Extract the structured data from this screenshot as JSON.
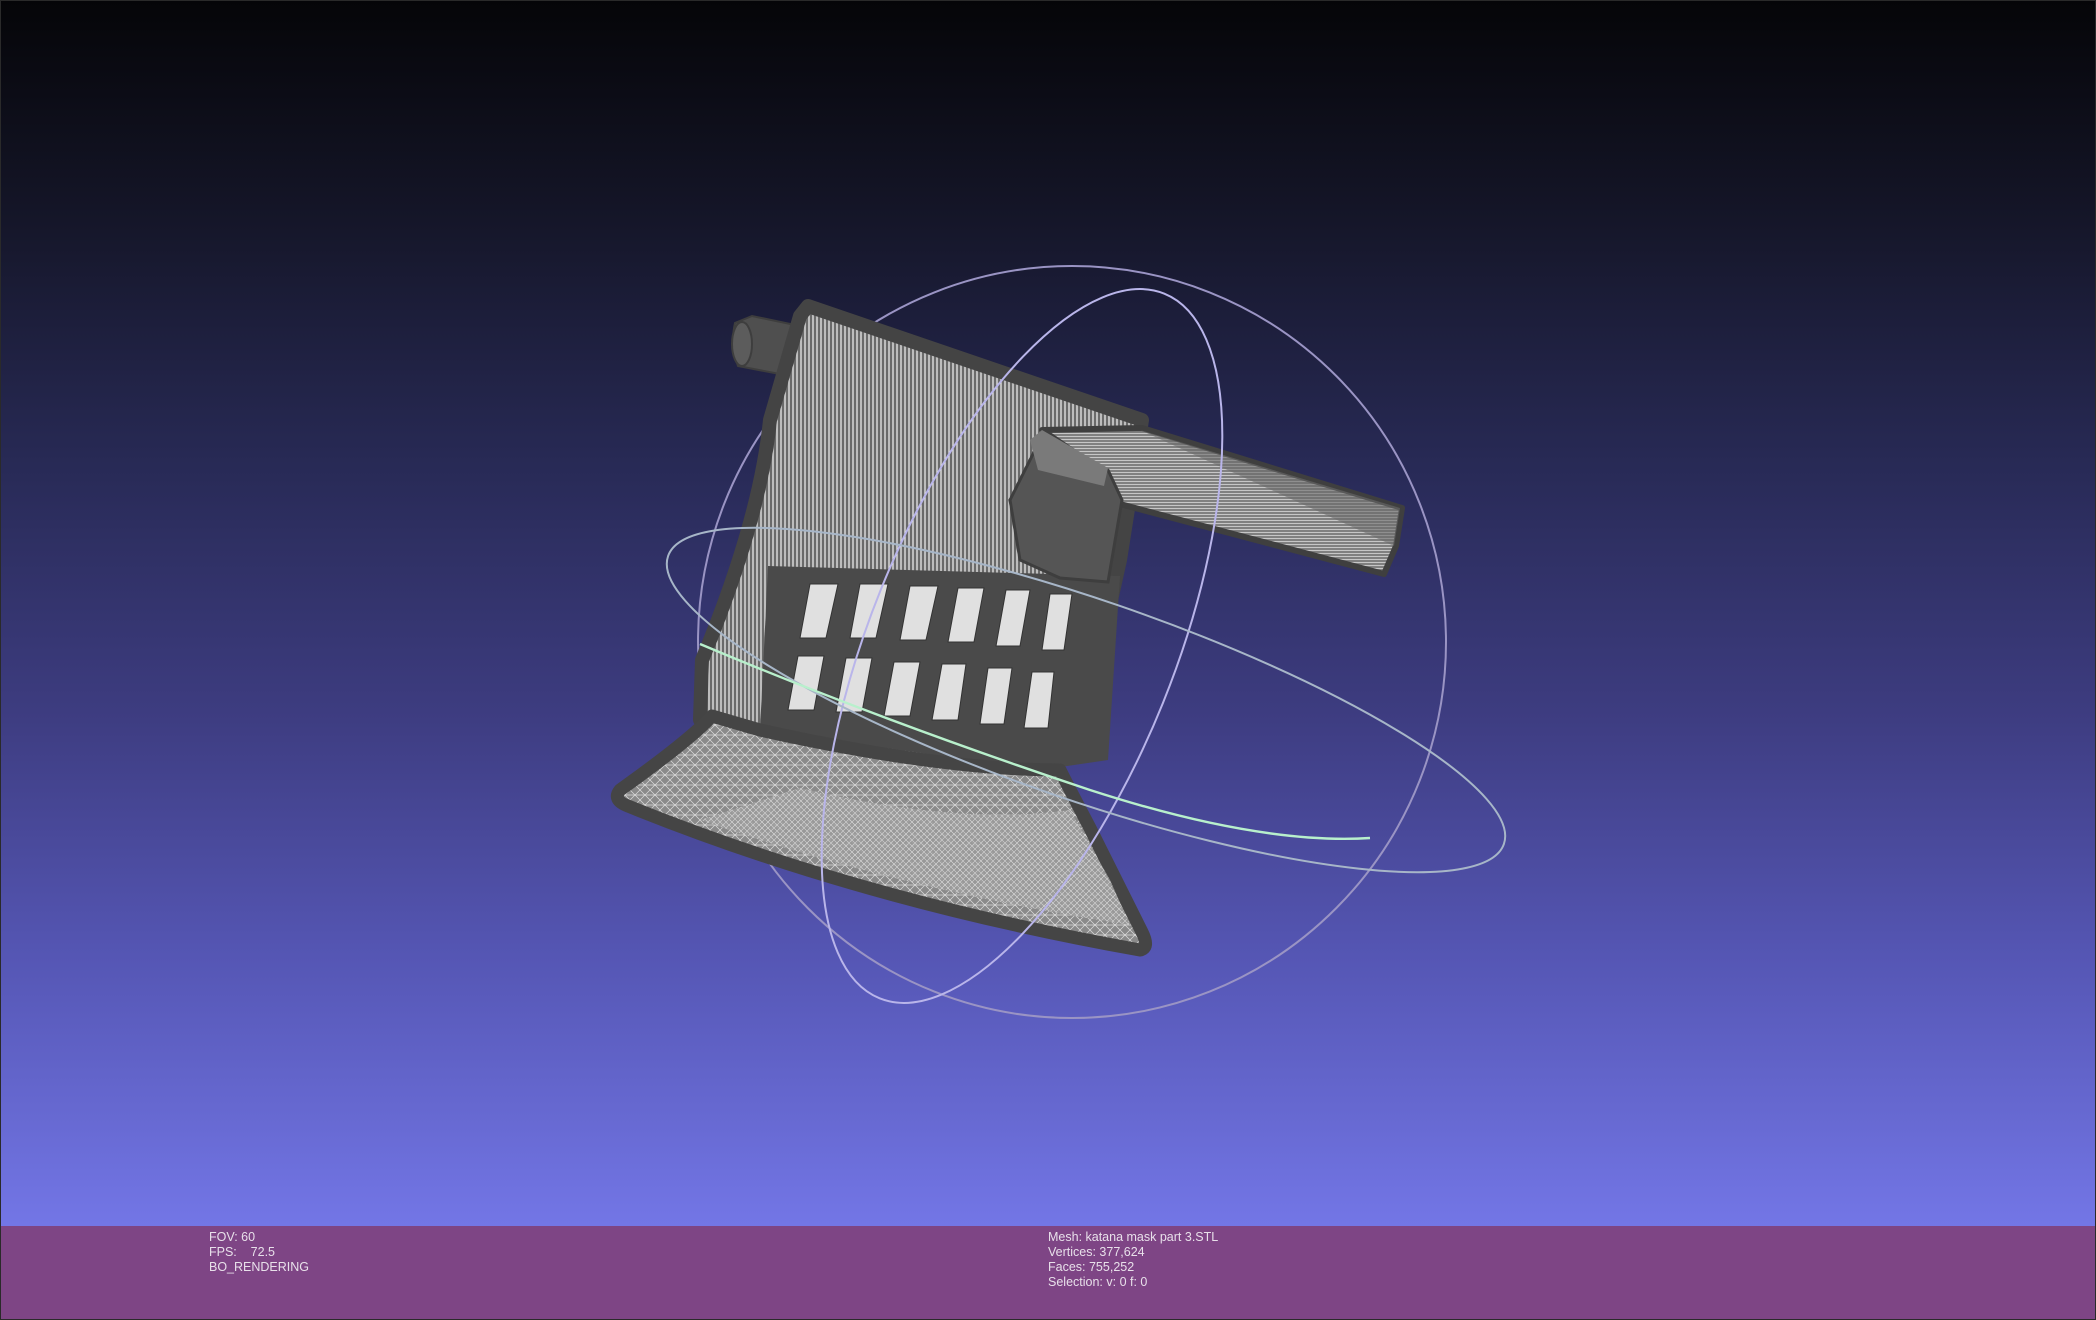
{
  "viewer": {
    "fov_line": "FOV: 60",
    "fps_line": "FPS:    72.5",
    "render_mode": "BO_RENDERING"
  },
  "mesh_info": {
    "mesh_line": "Mesh: katana mask part 3.STL",
    "vertices_line": "Vertices: 377,624",
    "faces_line": "Faces: 755,252",
    "selection_line": "Selection: v: 0 f: 0"
  },
  "colors": {
    "info_bar": "#7e4585",
    "background_top": "#050508",
    "background_bottom": "#7376e6",
    "mesh_fill": "#555555",
    "wireframe": "#e6e6e6",
    "trackball_horizontal": "#a8e8c0",
    "trackball_vertical": "#c8c4f0"
  }
}
